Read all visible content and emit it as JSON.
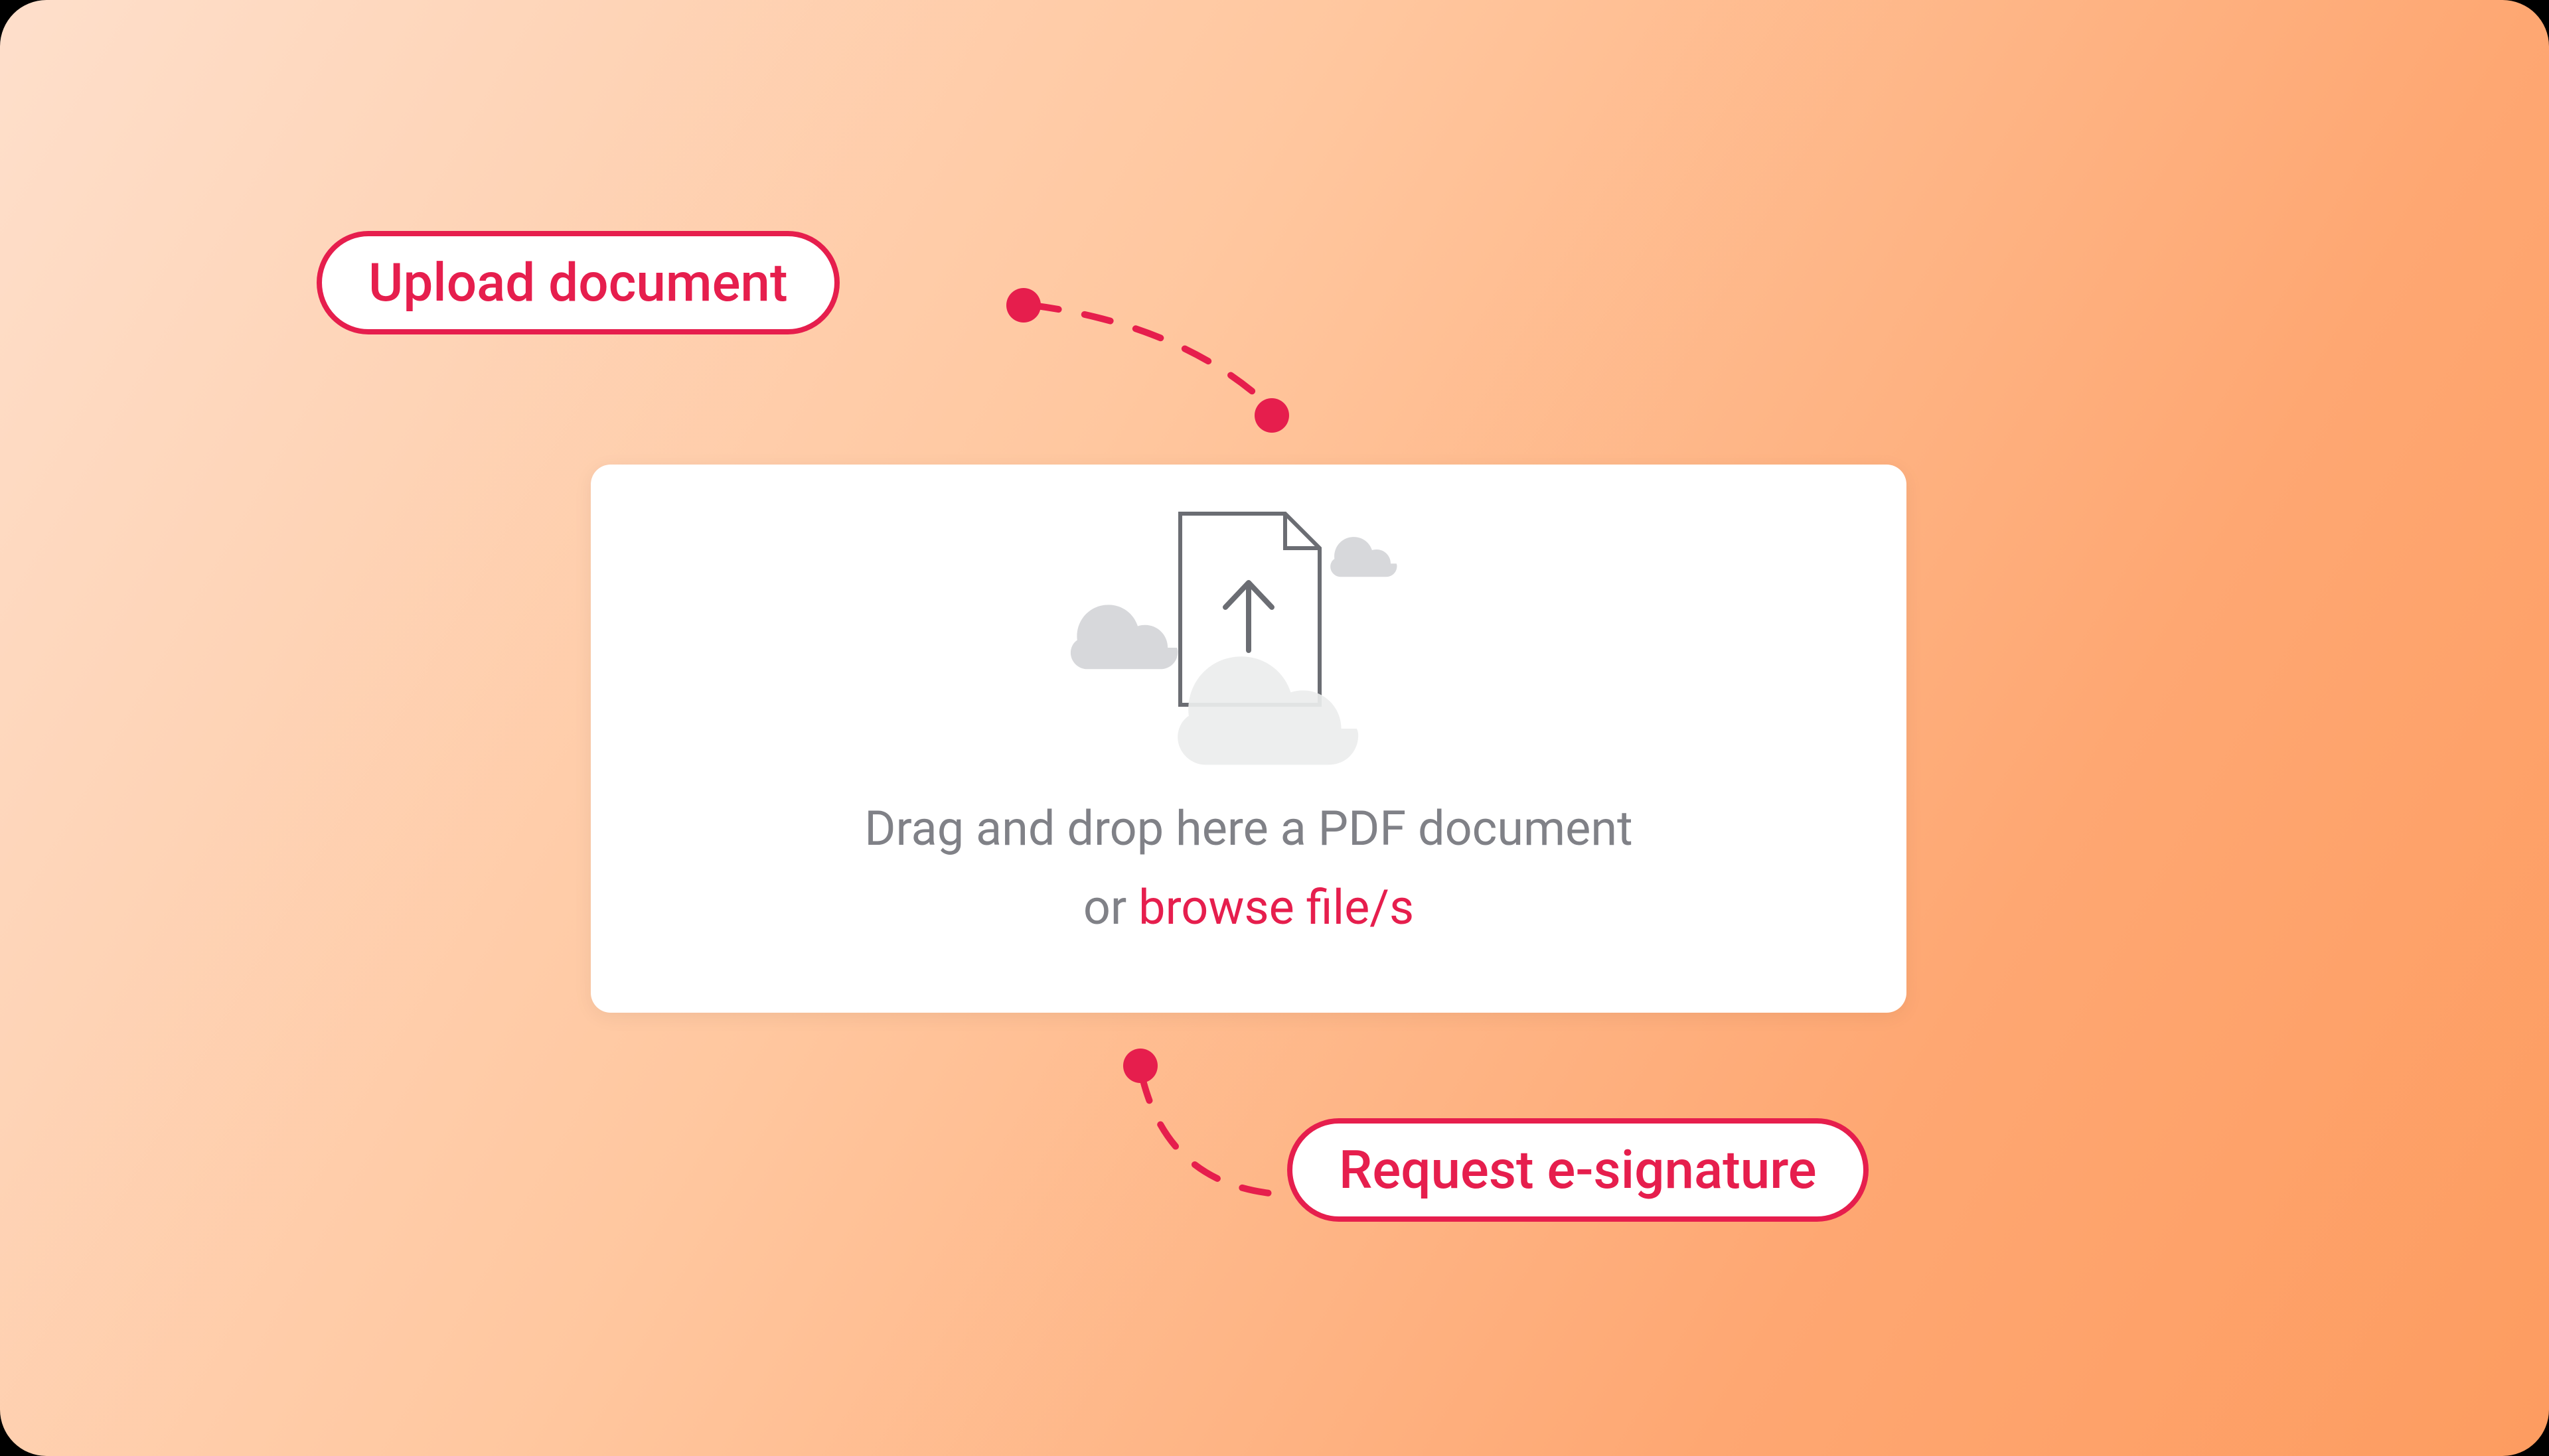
{
  "colors": {
    "accent": "#e61e4d",
    "text_muted": "#808187",
    "card_bg": "#ffffff"
  },
  "labels": {
    "upload_document": "Upload document",
    "request_esignature": "Request e-signature"
  },
  "dropzone": {
    "line1": "Drag and drop here a PDF document",
    "or": "or ",
    "browse_link": "browse file/s"
  },
  "icons": {
    "upload_document": "document-upload-icon",
    "cloud": "cloud-icon"
  }
}
